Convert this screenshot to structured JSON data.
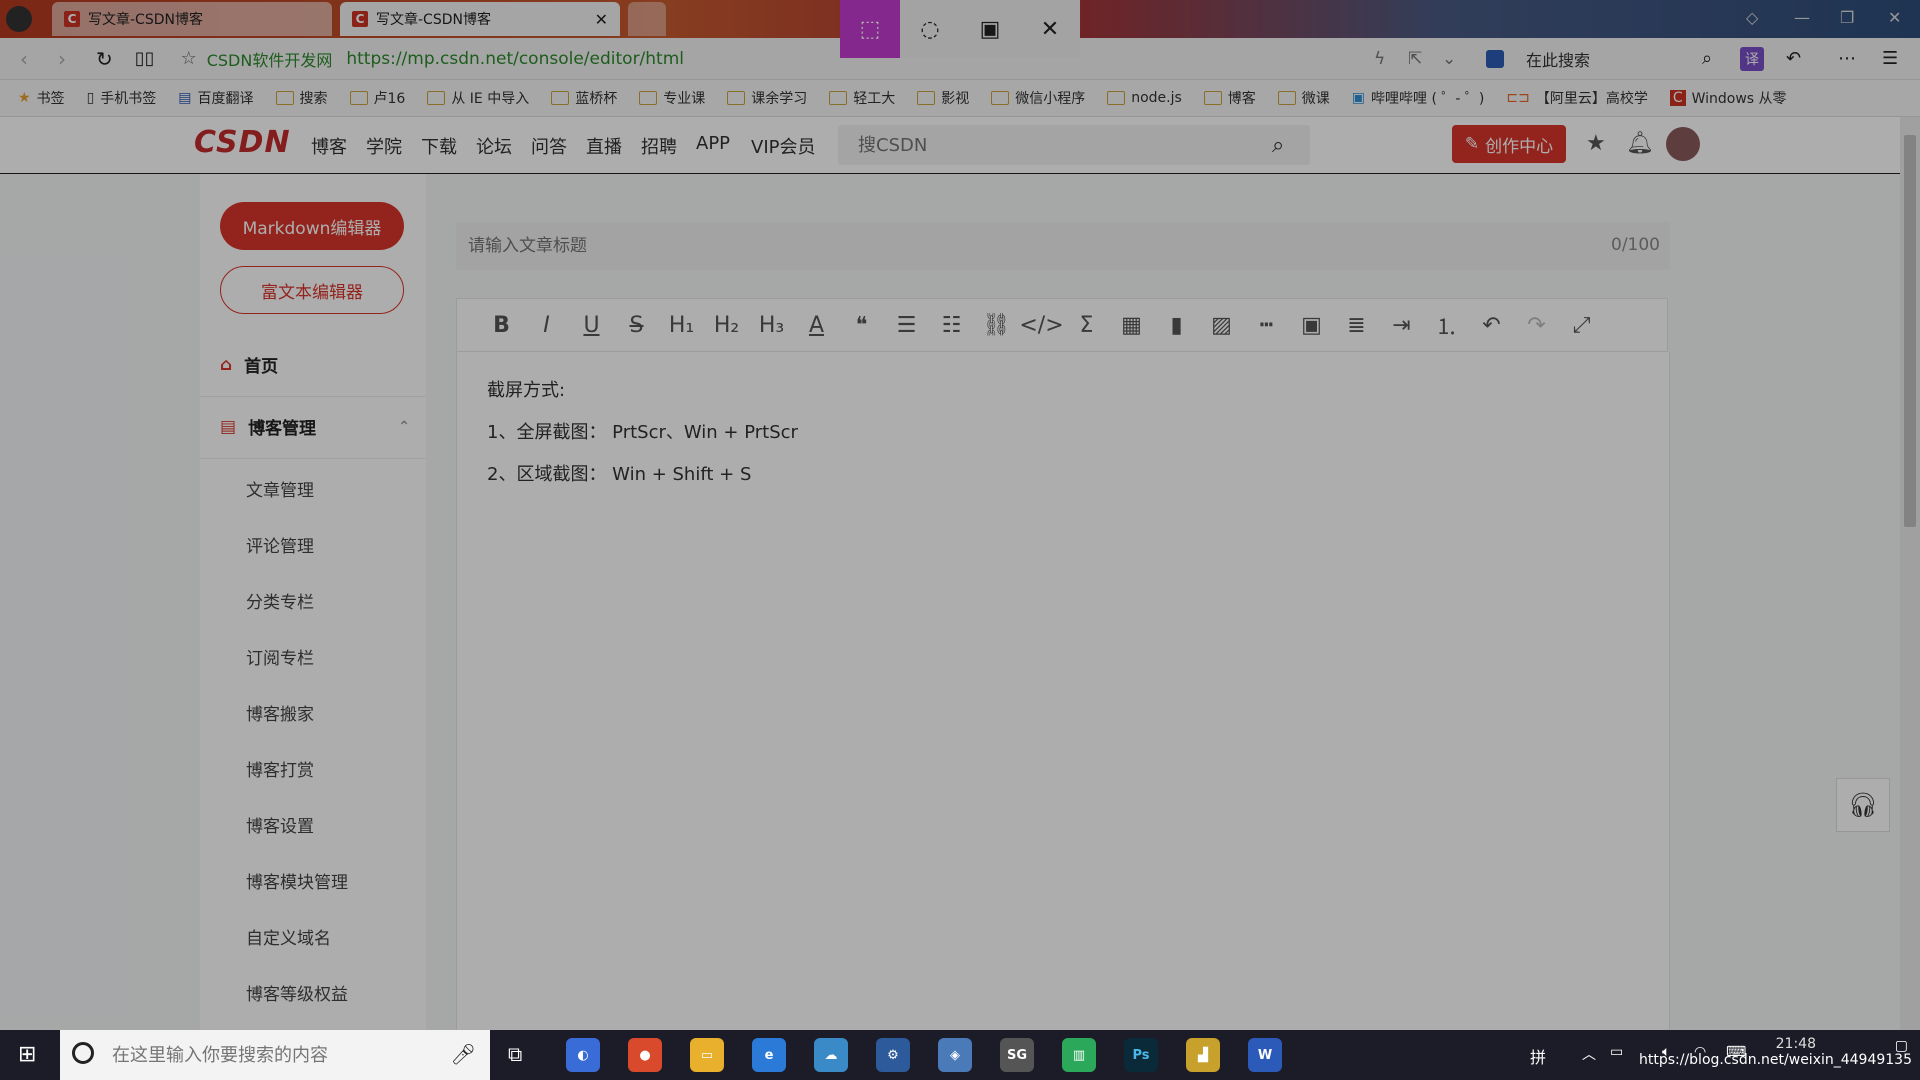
{
  "browser": {
    "tabs": [
      {
        "title": "写文章-CSDN博客"
      },
      {
        "title": "写文章-CSDN博客"
      }
    ],
    "address": {
      "site_label": "CSDN软件开发网",
      "url": "https://mp.csdn.net/console/editor/html"
    },
    "search_label": "在此搜索",
    "bookmarks": [
      "书签",
      "手机书签",
      "百度翻译",
      "搜索",
      "卢16",
      "从 IE 中导入",
      "蓝桥杯",
      "专业课",
      "课余学习",
      "轻工大",
      "影视",
      "微信小程序",
      "node.js",
      "博客",
      "微课",
      "哔哩哔哩 ( ゜- ゜)",
      "【阿里云】高校学",
      "Windows 从零"
    ]
  },
  "header": {
    "logo": "CSDN",
    "nav": [
      "博客",
      "学院",
      "下载",
      "论坛",
      "问答",
      "直播",
      "招聘",
      "APP",
      "VIP会员"
    ],
    "search_placeholder": "搜CSDN",
    "create_label": "创作中心"
  },
  "sidebar": {
    "markdown_label": "Markdown编辑器",
    "richtext_label": "富文本编辑器",
    "home_label": "首页",
    "blog_admin_label": "博客管理",
    "sub_items": [
      "文章管理",
      "评论管理",
      "分类专栏",
      "订阅专栏",
      "博客搬家",
      "博客打赏",
      "博客设置",
      "博客模块管理",
      "自定义域名",
      "博客等级权益"
    ]
  },
  "editor": {
    "title_placeholder": "请输入文章标题",
    "title_count": "0/100",
    "toolbar_icons": [
      "bold-icon",
      "italic-icon",
      "underline-icon",
      "strikethrough-icon",
      "h1-icon",
      "h2-icon",
      "h3-icon",
      "font-color-icon",
      "quote-icon",
      "ordered-list-icon",
      "unordered-list-icon",
      "link-icon",
      "code-icon",
      "formula-icon",
      "table-icon",
      "chart-icon",
      "image-icon",
      "hr-icon",
      "video-icon",
      "align-icon",
      "indent-icon",
      "list-number-icon",
      "undo-icon",
      "redo-icon",
      "fullscreen-icon"
    ],
    "paragraphs": [
      "截屏方式:",
      "1、全屏截图： PrtScr、Win + PrtScr",
      "2、区域截图： Win + Shift + S"
    ]
  },
  "taskbar": {
    "search_placeholder": "在这里输入你要搜索的内容",
    "time": "21:48",
    "status_url": "https://blog.csdn.net/weixin_44949135"
  }
}
